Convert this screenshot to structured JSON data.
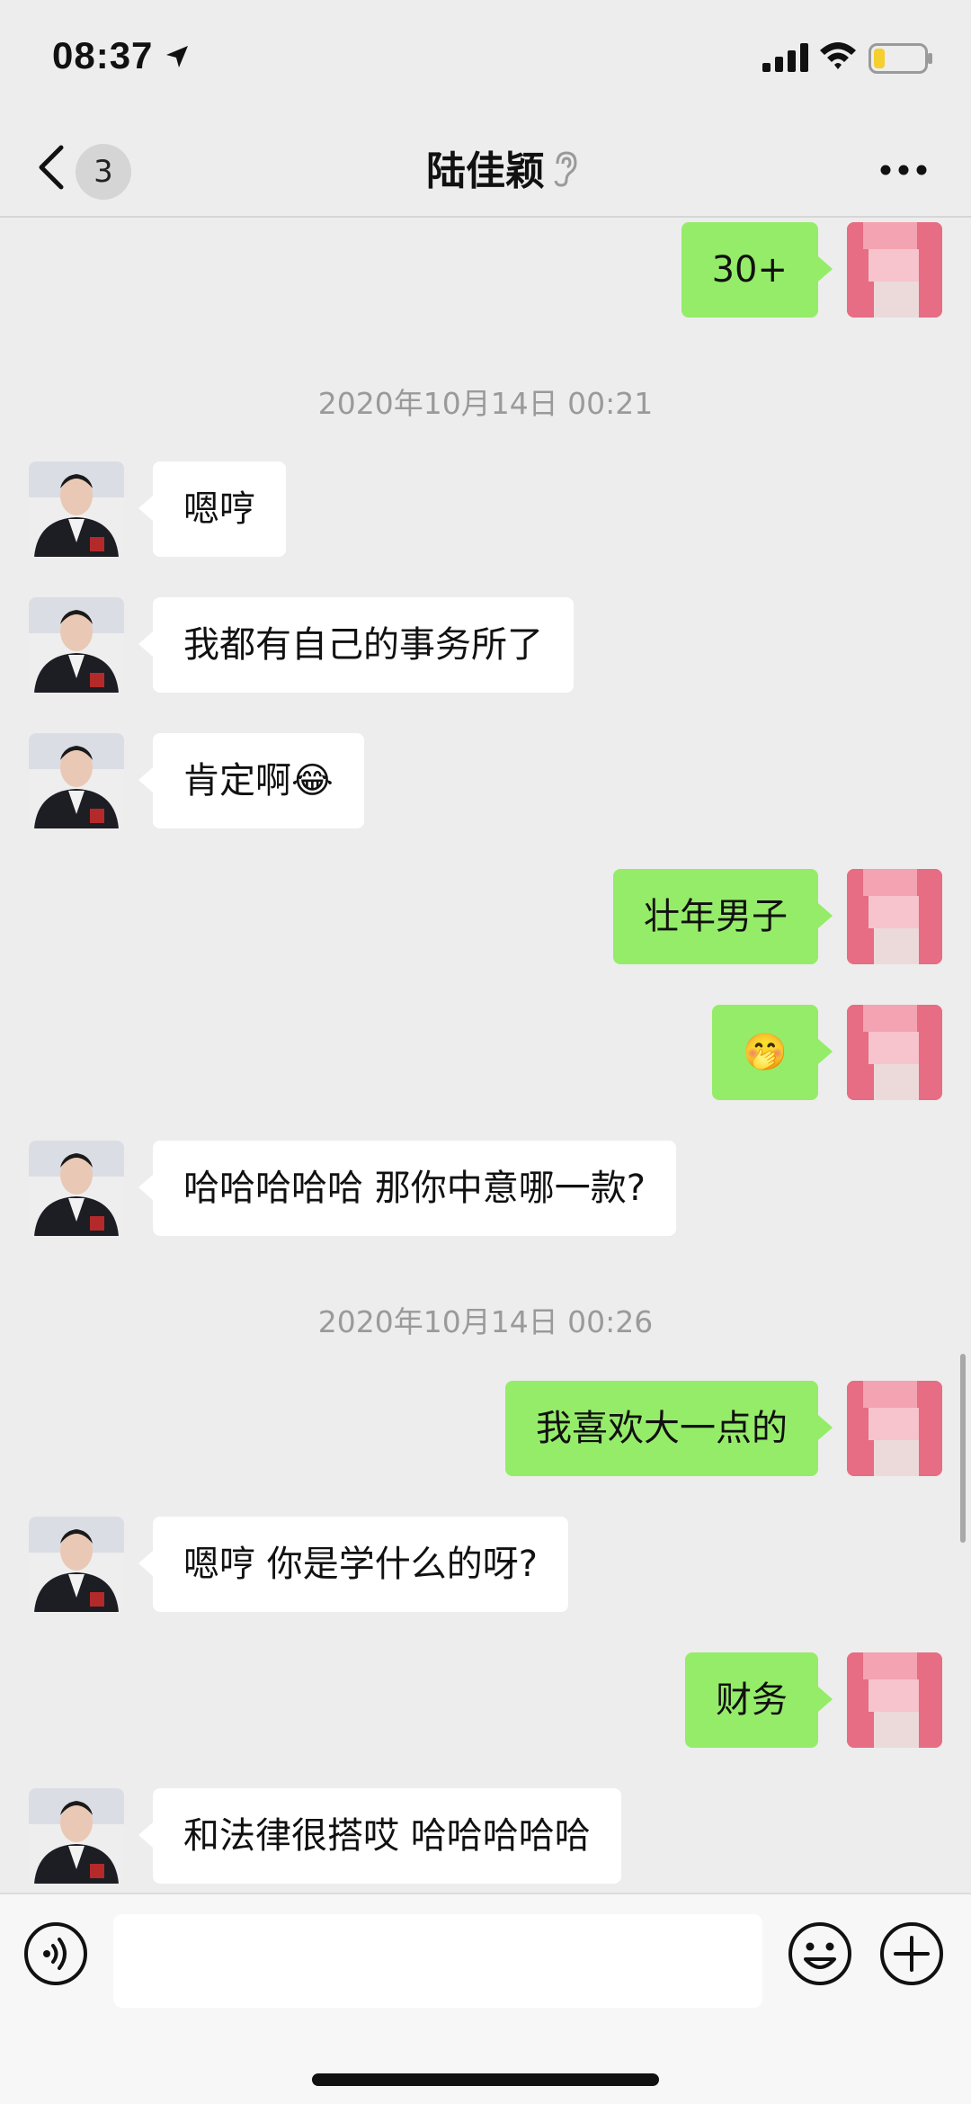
{
  "status_bar": {
    "time": "08:37"
  },
  "nav": {
    "unread_count": "3",
    "title": "陆佳颖"
  },
  "messages": [
    {
      "side": "out",
      "text": "30+"
    },
    {
      "side": "in",
      "text": "嗯哼"
    },
    {
      "side": "in",
      "text": "我都有自己的事务所了"
    },
    {
      "side": "in",
      "text": "肯定啊",
      "emoji": "😂"
    },
    {
      "side": "out",
      "text": "壮年男子"
    },
    {
      "side": "out",
      "text": "",
      "emoji": "🤭"
    },
    {
      "side": "in",
      "text": "哈哈哈哈哈 那你中意哪一款?"
    },
    {
      "side": "out",
      "text": "我喜欢大一点的"
    },
    {
      "side": "in",
      "text": "嗯哼 你是学什么的呀?"
    },
    {
      "side": "out",
      "text": "财务"
    },
    {
      "side": "in",
      "text": "和法律很搭哎 哈哈哈哈哈"
    }
  ],
  "timestamps": [
    "2020年10月14日 00:21",
    "2020年10月14日 00:26"
  ],
  "colors": {
    "background": "#ededed",
    "out_bubble": "#95ec69",
    "in_bubble": "#ffffff"
  },
  "icons": [
    "back-icon",
    "ear-icon",
    "more-icon",
    "voice-icon",
    "emoji-icon",
    "add-icon"
  ]
}
